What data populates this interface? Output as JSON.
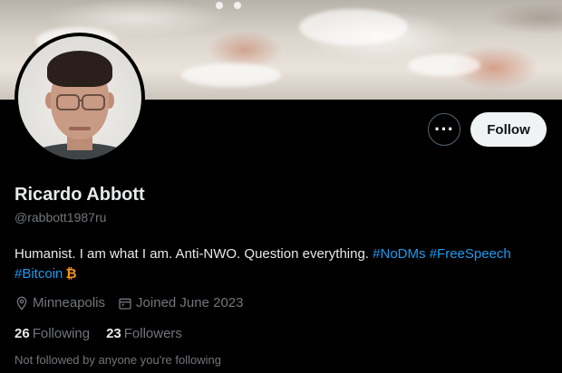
{
  "profile": {
    "name": "Ricardo Abbott",
    "handle": "@rabbott1987ru",
    "bio_text": "Humanist. I am what I am. Anti-NWO. Question everything.",
    "hashtags": [
      "#NoDMs",
      "#FreeSpeech",
      "#Bitcoin"
    ],
    "bitcoin_icon": "₿",
    "location": "Minneapolis",
    "joined": "Joined June 2023",
    "following_count": "26",
    "following_label": "Following",
    "followers_count": "23",
    "followers_label": "Followers",
    "followed_by": "Not followed by anyone you're following"
  },
  "actions": {
    "more_label": "···",
    "follow_label": "Follow"
  },
  "icons": {
    "more": "more-options-icon",
    "location": "location-pin-icon",
    "calendar": "calendar-icon",
    "bitcoin": "bitcoin-icon"
  },
  "colors": {
    "background": "#000000",
    "text": "#e7e9ea",
    "secondary": "#71767b",
    "link": "#1d9bf0",
    "follow_bg": "#eff3f4"
  }
}
